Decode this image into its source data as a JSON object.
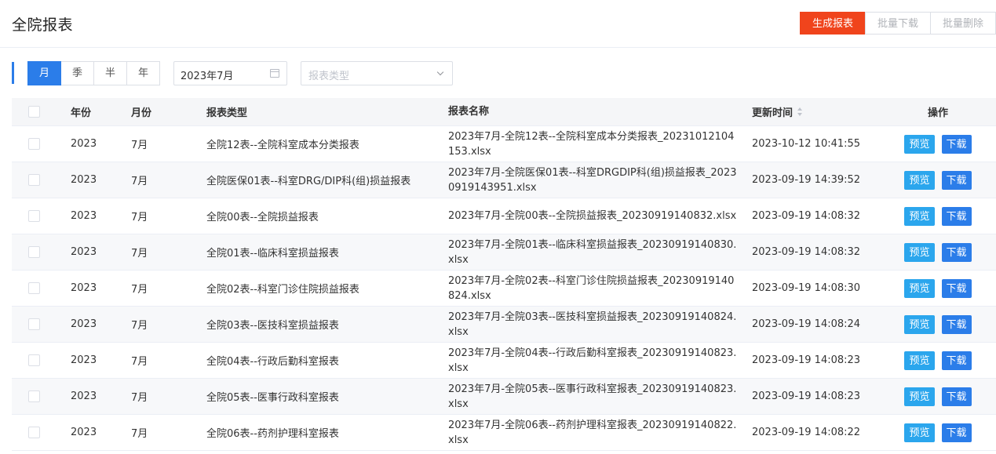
{
  "header": {
    "title": "全院报表",
    "buttons": {
      "generate": "生成报表",
      "batch_download": "批量下载",
      "batch_delete": "批量删除"
    }
  },
  "filters": {
    "periods": [
      "月",
      "季",
      "半",
      "年"
    ],
    "active_period": "月",
    "date_value": "2023年7月",
    "report_type_placeholder": "报表类型"
  },
  "table": {
    "columns": {
      "year": "年份",
      "month": "月份",
      "type": "报表类型",
      "name": "报表名称",
      "updated": "更新时间",
      "actions": "操作"
    },
    "action_labels": {
      "preview": "预览",
      "download": "下载"
    },
    "rows": [
      {
        "year": "2023",
        "month": "7月",
        "type": "全院12表--全院科室成本分类报表",
        "name": "2023年7月-全院12表--全院科室成本分类报表_20231012104153.xlsx",
        "updated": "2023-10-12 10:41:55"
      },
      {
        "year": "2023",
        "month": "7月",
        "type": "全院医保01表--科室DRG/DIP科(组)损益报表",
        "name": "2023年7月-全院医保01表--科室DRGDIP科(组)损益报表_20230919143951.xlsx",
        "updated": "2023-09-19 14:39:52"
      },
      {
        "year": "2023",
        "month": "7月",
        "type": "全院00表--全院损益报表",
        "name": "2023年7月-全院00表--全院损益报表_20230919140832.xlsx",
        "updated": "2023-09-19 14:08:32"
      },
      {
        "year": "2023",
        "month": "7月",
        "type": "全院01表--临床科室损益报表",
        "name": "2023年7月-全院01表--临床科室损益报表_20230919140830.xlsx",
        "updated": "2023-09-19 14:08:32"
      },
      {
        "year": "2023",
        "month": "7月",
        "type": "全院02表--科室门诊住院损益报表",
        "name": "2023年7月-全院02表--科室门诊住院损益报表_20230919140824.xlsx",
        "updated": "2023-09-19 14:08:30"
      },
      {
        "year": "2023",
        "month": "7月",
        "type": "全院03表--医技科室损益报表",
        "name": "2023年7月-全院03表--医技科室损益报表_20230919140824.xlsx",
        "updated": "2023-09-19 14:08:24"
      },
      {
        "year": "2023",
        "month": "7月",
        "type": "全院04表--行政后勤科室报表",
        "name": "2023年7月-全院04表--行政后勤科室报表_20230919140823.xlsx",
        "updated": "2023-09-19 14:08:23"
      },
      {
        "year": "2023",
        "month": "7月",
        "type": "全院05表--医事行政科室报表",
        "name": "2023年7月-全院05表--医事行政科室报表_20230919140823.xlsx",
        "updated": "2023-09-19 14:08:23"
      },
      {
        "year": "2023",
        "month": "7月",
        "type": "全院06表--药剂护理科室报表",
        "name": "2023年7月-全院06表--药剂护理科室报表_20230919140822.xlsx",
        "updated": "2023-09-19 14:08:22"
      }
    ]
  }
}
